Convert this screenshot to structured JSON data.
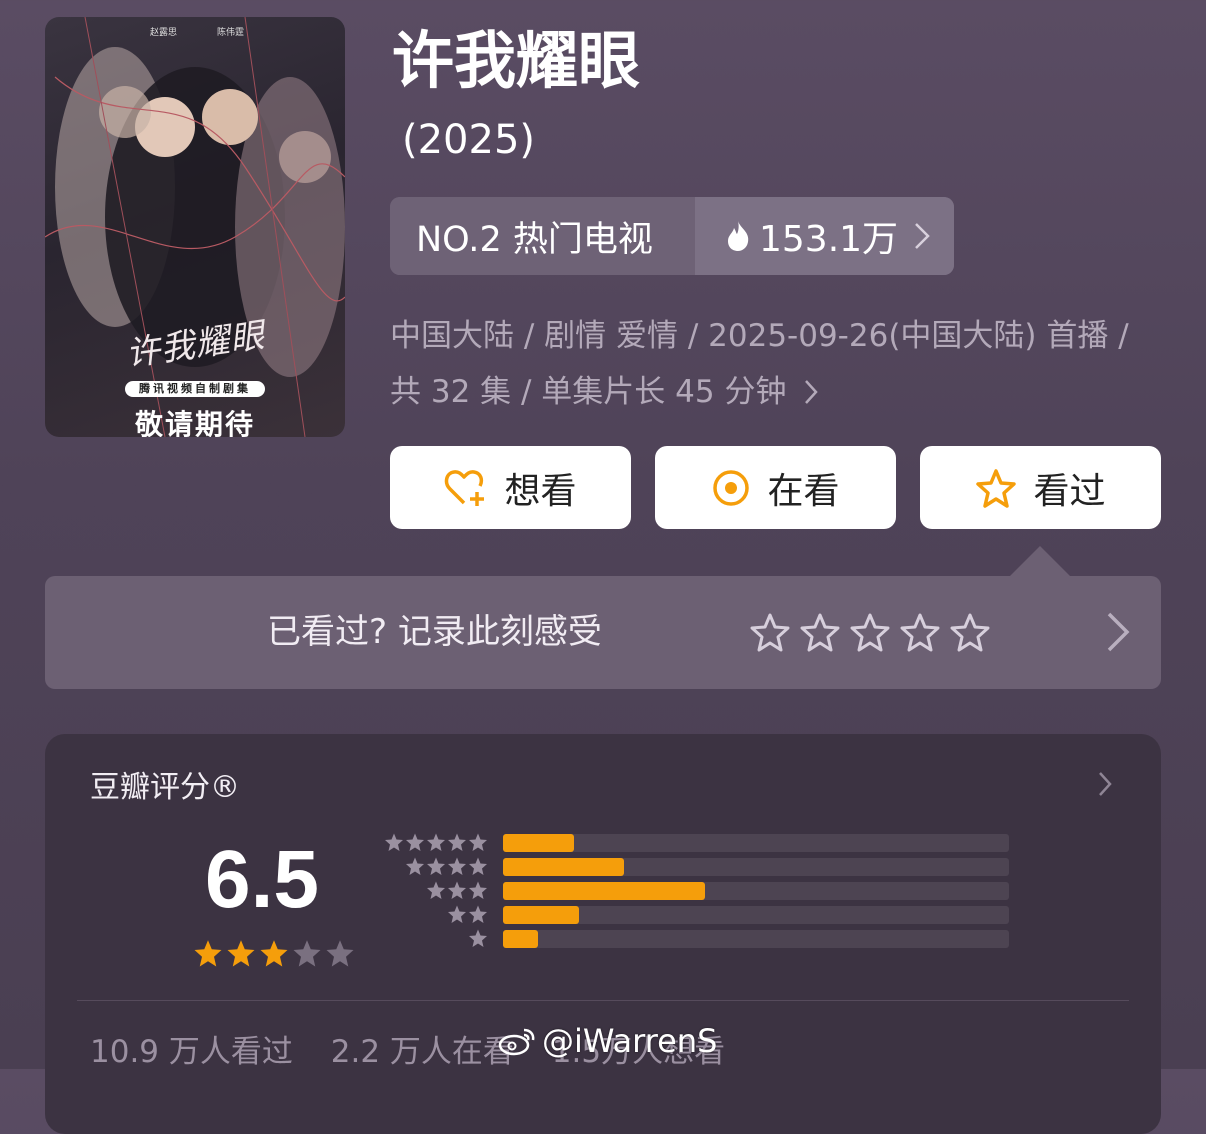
{
  "poster": {
    "cast_left": "赵露思",
    "cast_right": "陈伟霆",
    "title_art": "许我耀眼",
    "badge": "腾讯视频自制剧集",
    "coming_soon": "敬请期待"
  },
  "title": "许我耀眼",
  "year": "(2025)",
  "rank": {
    "label": "NO.2 热门电视",
    "heat": "153.1万",
    "chevron": "›"
  },
  "meta": {
    "line": "中国大陆 / 剧情 爱情 / 2025-09-26(中国大陆) 首播 / 共 32 集 / 单集片长 45 分钟",
    "chevron": "›"
  },
  "buttons": {
    "want": "想看",
    "watching": "在看",
    "watched": "看过"
  },
  "record": {
    "text": "已看过? 记录此刻感受",
    "star_count": 5
  },
  "rating": {
    "label": "豆瓣评分®",
    "score": "6.5",
    "stars_filled": 3,
    "stars_total": 5,
    "distribution": [
      {
        "stars": 5,
        "fraction": 0.14
      },
      {
        "stars": 4,
        "fraction": 0.24
      },
      {
        "stars": 3,
        "fraction": 0.4
      },
      {
        "stars": 2,
        "fraction": 0.15
      },
      {
        "stars": 1,
        "fraction": 0.07
      }
    ],
    "footer": [
      "10.9 万人看过",
      "2.2 万人在看",
      "1.5万人想看"
    ]
  },
  "watermark": "@iWarrenS",
  "colors": {
    "accent": "#f59e0b",
    "background": "#534659",
    "card": "#3c3342"
  }
}
